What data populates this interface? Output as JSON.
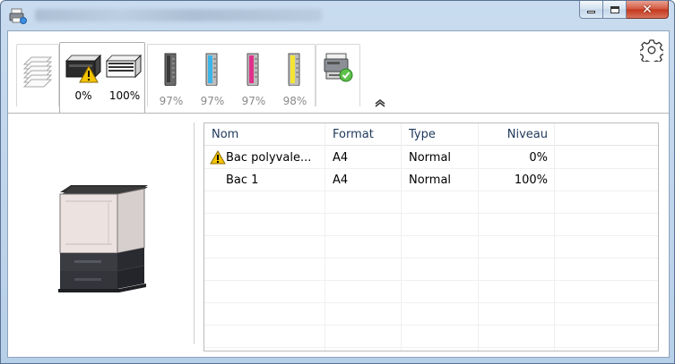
{
  "window": {
    "icon": "printer-app-icon",
    "title_obscured": true,
    "buttons": {
      "minimize_icon": "minimize-icon",
      "maximize_icon": "maximize-icon",
      "close_icon": "close-icon",
      "close_glyph": "✕"
    }
  },
  "tabs": [
    {
      "id": "jobs",
      "icon": "print-queue-icon",
      "label": ""
    },
    {
      "id": "paper",
      "icon": "paper-tray-icon",
      "labels": [
        "0%",
        "100%"
      ],
      "active": true,
      "warning": true
    },
    {
      "id": "toner",
      "icon": "toner-icon",
      "labels": [
        "97%",
        "97%",
        "97%",
        "98%"
      ],
      "colors": [
        "#5a5a5a",
        "#3cb5e8",
        "#e0308a",
        "#f3e534"
      ]
    },
    {
      "id": "status",
      "icon": "device-status-icon",
      "label": ""
    }
  ],
  "collapse_icon": "chevron-up-icon",
  "settings_icon": "gear-icon",
  "device_image": "printer-device-illustration",
  "table": {
    "columns": [
      "Nom",
      "Format",
      "Type",
      "Niveau"
    ],
    "rows": [
      {
        "warning": true,
        "name": "Bac polyvale...",
        "format": "A4",
        "type": "Normal",
        "level": "0%"
      },
      {
        "warning": false,
        "name": "Bac 1",
        "format": "A4",
        "type": "Normal",
        "level": "100%"
      }
    ]
  },
  "colors": {
    "title_bar": "#c9dcef",
    "close_button": "#c4361b",
    "warning": "#f5c400",
    "header_text": "#1e395b"
  }
}
